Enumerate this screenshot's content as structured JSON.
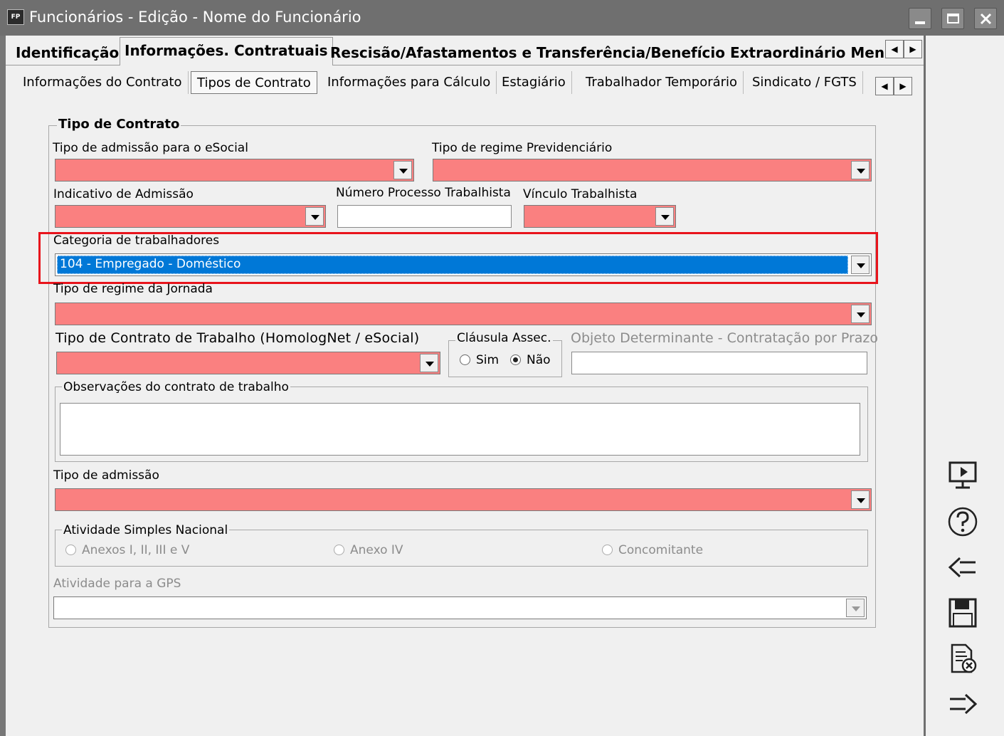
{
  "window": {
    "app_badge": "FP",
    "title": "Funcionários - Edição - Nome do Funcionário"
  },
  "main_tabs": [
    {
      "label": "Identificação"
    },
    {
      "label": "Informações. Contratuais"
    },
    {
      "label": "Rescisão/Afastamentos e Transferência/Benefício Extraordinário Mensal"
    }
  ],
  "sub_tabs": [
    {
      "label": "Informações do Contrato"
    },
    {
      "label": "Tipos de Contrato"
    },
    {
      "label": "Informações para Cálculo"
    },
    {
      "label": "Estagiário"
    },
    {
      "label": "Trabalhador Temporário"
    },
    {
      "label": "Sindicato / FGTS"
    }
  ],
  "form": {
    "group_title": "Tipo de Contrato",
    "admission_esocial_label": "Tipo de admissão para o eSocial",
    "social_security_regime_label": "Tipo de regime Previdenciário",
    "admission_indicator_label": "Indicativo de Admissão",
    "labor_process_label": "Número Processo Trabalhista",
    "labor_bond_label": "Vínculo Trabalhista",
    "worker_category_label": "Categoria de trabalhadores",
    "worker_category_value": "104 - Empregado - Doméstico",
    "workday_regime_label": "Tipo de regime da Jornada",
    "contract_type_label": "Tipo de Contrato de Trabalho (HomologNet / eSocial)",
    "clause_title": "Cláusula Assec.",
    "clause_yes": "Sim",
    "clause_no": "Não",
    "determining_object_label": "Objeto Determinante - Contratação por Prazo",
    "observations_title": "Observações do contrato de trabalho",
    "admission_type_label": "Tipo de admissão",
    "simples_title": "Atividade Simples Nacional",
    "simples_options": [
      "Anexos I, II, III e V",
      "Anexo IV",
      "Concomitante"
    ],
    "gps_activity_label": "Atividade para a GPS"
  },
  "colors": {
    "required_field": "#fa8080",
    "selected_bg": "#0078d7",
    "highlight_border": "#e8141c",
    "titlebar": "#6f6f6f"
  },
  "side_toolbar": [
    "monitor-icon",
    "help-icon",
    "back-arrow-icon",
    "save-icon",
    "cancel-document-icon",
    "forward-arrow-icon"
  ]
}
